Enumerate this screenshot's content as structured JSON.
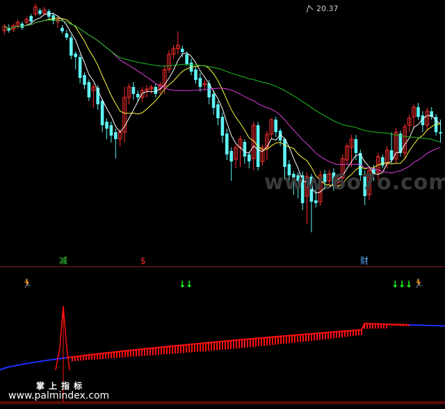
{
  "chart": {
    "peak_price_label": "20.37",
    "watermark_text": "www.6o7o.com",
    "signal_labels": [
      {
        "text": "减",
        "color": "#39d539"
      },
      {
        "text": "$",
        "color": "#ff2b2b"
      },
      {
        "text": "财",
        "color": "#5ab0ff"
      }
    ],
    "markers": [
      {
        "name": "runner",
        "glyph": "🏃",
        "color": "#ff9f1a"
      },
      {
        "name": "down-arrows",
        "glyph": "↓↓",
        "color": "#19ff19"
      },
      {
        "name": "down-arrows",
        "glyph": "↓↓↓",
        "color": "#19ff19"
      },
      {
        "name": "runner",
        "glyph": "🏃",
        "color": "#ff9f1a"
      }
    ],
    "indicator_name": "掌上指标",
    "site_text": "www.palmindex.com",
    "colors": {
      "up_candle": "#ff3030",
      "down_candle": "#5ff3f3",
      "ma_white": "#ffffff",
      "ma_yellow": "#ffff40",
      "ma_magenta": "#e040e0",
      "ma_green": "#20c020",
      "indicator_red": "#ff1010",
      "indicator_blue": "#2030ff"
    }
  },
  "chart_data": {
    "type": "candlestick",
    "title": "",
    "peak_high": 20.37,
    "candles": [
      [
        296,
        302,
        290,
        306
      ],
      [
        300,
        296,
        293,
        305
      ],
      [
        298,
        303,
        294,
        306
      ],
      [
        302,
        308,
        299,
        311
      ],
      [
        306,
        300,
        297,
        309
      ],
      [
        308,
        312,
        303,
        316
      ],
      [
        317,
        309,
        305,
        320
      ],
      [
        320,
        330,
        317,
        335
      ],
      [
        325,
        320,
        318,
        328
      ],
      [
        321,
        326,
        318,
        330
      ],
      [
        324,
        316,
        312,
        327
      ],
      [
        318,
        310,
        305,
        322
      ],
      [
        309,
        312,
        300,
        315
      ],
      [
        300,
        295,
        292,
        304
      ],
      [
        292,
        286,
        282,
        297
      ],
      [
        286,
        260,
        255,
        290
      ],
      [
        263,
        258,
        240,
        266
      ],
      [
        258,
        228,
        220,
        262
      ],
      [
        232,
        218,
        212,
        236
      ],
      [
        222,
        200,
        195,
        226
      ],
      [
        210,
        215,
        185,
        220
      ],
      [
        214,
        190,
        182,
        218
      ],
      [
        195,
        160,
        150,
        198
      ],
      [
        165,
        155,
        140,
        170
      ],
      [
        160,
        145,
        135,
        165
      ],
      [
        150,
        140,
        112,
        155
      ],
      [
        140,
        150,
        130,
        155
      ],
      [
        150,
        200,
        135,
        215
      ],
      [
        200,
        215,
        190,
        220
      ],
      [
        215,
        205,
        197,
        222
      ],
      [
        205,
        200,
        195,
        210
      ],
      [
        200,
        210,
        193,
        215
      ],
      [
        210,
        212,
        200,
        218
      ],
      [
        212,
        215,
        205,
        218
      ],
      [
        215,
        205,
        200,
        220
      ],
      [
        212,
        218,
        205,
        222
      ],
      [
        216,
        240,
        205,
        245
      ],
      [
        240,
        262,
        235,
        268
      ],
      [
        262,
        270,
        255,
        275
      ],
      [
        270,
        275,
        262,
        295
      ],
      [
        270,
        265,
        258,
        274
      ],
      [
        262,
        248,
        245,
        266
      ],
      [
        250,
        237,
        232,
        256
      ],
      [
        240,
        225,
        220,
        245
      ],
      [
        228,
        215,
        208,
        235
      ],
      [
        218,
        220,
        210,
        225
      ],
      [
        220,
        200,
        190,
        225
      ],
      [
        205,
        185,
        175,
        210
      ],
      [
        190,
        170,
        160,
        195
      ],
      [
        172,
        145,
        135,
        178
      ],
      [
        148,
        118,
        110,
        155
      ],
      [
        123,
        108,
        80,
        128
      ],
      [
        111,
        128,
        98,
        132
      ],
      [
        128,
        140,
        100,
        145
      ],
      [
        136,
        115,
        105,
        140
      ],
      [
        118,
        108,
        98,
        122
      ],
      [
        112,
        160,
        95,
        165
      ],
      [
        160,
        100,
        95,
        165
      ],
      [
        108,
        128,
        102,
        132
      ],
      [
        128,
        147,
        110,
        152
      ],
      [
        147,
        168,
        140,
        170
      ],
      [
        168,
        150,
        143,
        172
      ],
      [
        152,
        138,
        130,
        155
      ],
      [
        140,
        100,
        82,
        142
      ],
      [
        104,
        88,
        72,
        110
      ],
      [
        90,
        85,
        60,
        94
      ],
      [
        88,
        80,
        55,
        92
      ],
      [
        88,
        48,
        38,
        94
      ],
      [
        58,
        86,
        18,
        92
      ],
      [
        86,
        50,
        6,
        90
      ],
      [
        52,
        48,
        42,
        72
      ],
      [
        50,
        88,
        44,
        95
      ],
      [
        90,
        78,
        68,
        96
      ],
      [
        80,
        90,
        74,
        96
      ],
      [
        92,
        74,
        66,
        98
      ],
      [
        78,
        82,
        70,
        88
      ],
      [
        84,
        112,
        78,
        118
      ],
      [
        110,
        130,
        104,
        134
      ],
      [
        128,
        140,
        100,
        146
      ],
      [
        140,
        120,
        110,
        146
      ],
      [
        120,
        88,
        80,
        125
      ],
      [
        90,
        58,
        45,
        95
      ],
      [
        60,
        95,
        52,
        100
      ],
      [
        98,
        90,
        80,
        103
      ],
      [
        92,
        115,
        80,
        120
      ],
      [
        114,
        102,
        98,
        118
      ],
      [
        104,
        124,
        98,
        130
      ],
      [
        124,
        110,
        105,
        150
      ],
      [
        112,
        150,
        105,
        156
      ],
      [
        148,
        120,
        115,
        152
      ],
      [
        120,
        158,
        112,
        162
      ],
      [
        160,
        170,
        150,
        175
      ],
      [
        172,
        186,
        155,
        190
      ],
      [
        186,
        172,
        168,
        192
      ],
      [
        174,
        160,
        150,
        180
      ],
      [
        160,
        180,
        152,
        185
      ],
      [
        180,
        172,
        168,
        186
      ],
      [
        172,
        150,
        145,
        176
      ],
      [
        150,
        148,
        135,
        168
      ]
    ],
    "moving_averages": [
      "white",
      "yellow",
      "magenta",
      "green"
    ],
    "indicator": {
      "type": "area",
      "upper_band_start": 532,
      "upper_band_end": 465,
      "spike_peak": 440,
      "baseline": 578
    }
  }
}
